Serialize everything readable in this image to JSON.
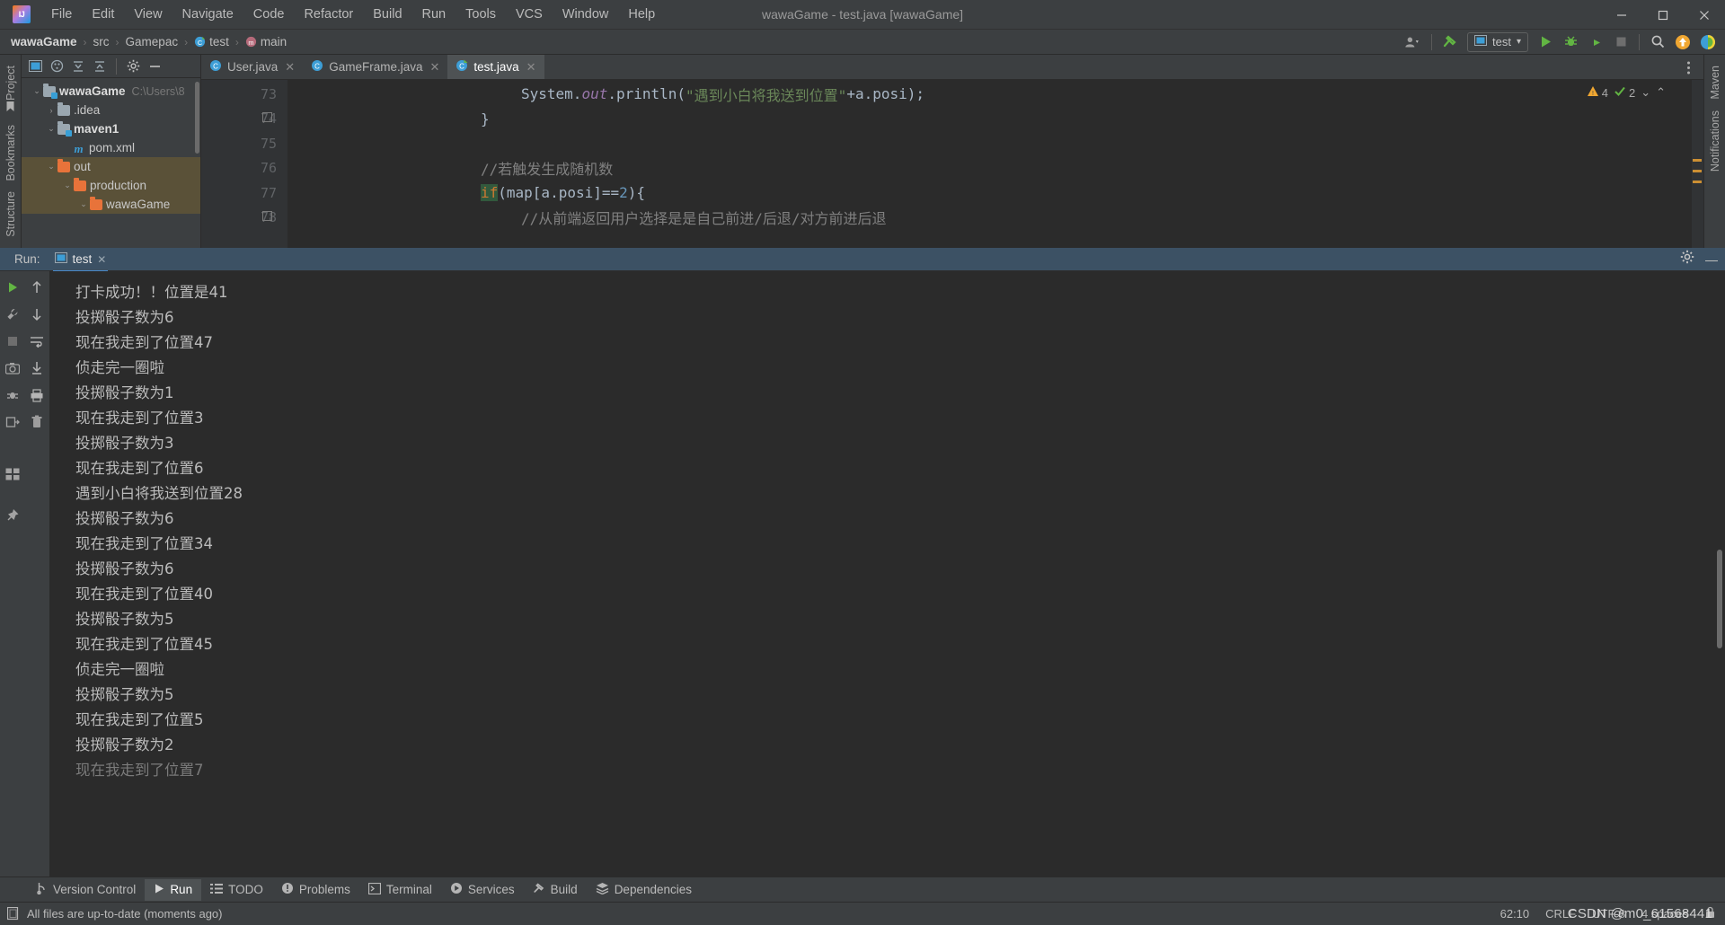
{
  "window": {
    "title": "wawaGame - test.java [wawaGame]",
    "logo_icon": "intellij-idea-logo",
    "minimize_icon": "minimize-icon",
    "maximize_icon": "maximize-icon",
    "close_icon": "close-icon",
    "minimize_glyph": "—",
    "maximize_glyph": "☐",
    "close_glyph": "✕"
  },
  "menubar": {
    "items": [
      {
        "label": "File"
      },
      {
        "label": "Edit"
      },
      {
        "label": "View"
      },
      {
        "label": "Navigate"
      },
      {
        "label": "Code"
      },
      {
        "label": "Refactor"
      },
      {
        "label": "Build"
      },
      {
        "label": "Run"
      },
      {
        "label": "Tools"
      },
      {
        "label": "VCS"
      },
      {
        "label": "Window"
      },
      {
        "label": "Help"
      }
    ]
  },
  "breadcrumb": {
    "items": [
      {
        "label": "wawaGame",
        "icon": ""
      },
      {
        "label": "src",
        "icon": ""
      },
      {
        "label": "Gamepac",
        "icon": ""
      },
      {
        "label": "test",
        "icon": "java-class-icon"
      },
      {
        "label": "main",
        "icon": "java-method-icon"
      }
    ],
    "separator": "›"
  },
  "navbar_right": {
    "account_label": "account-icon",
    "build_label": "build-hammer-icon",
    "run_config_name": "test",
    "run_config_icon": "run-configuration-icon",
    "dropdown_glyph": "▾",
    "run_icon": "run-button",
    "debug_icon": "debug-button",
    "coverage_icon": "run-with-coverage-button",
    "stop_icon": "stop-button",
    "search_icon": "search-everywhere-icon",
    "update_icon": "update-project-icon",
    "ide_icon": "ide-feature-icon"
  },
  "left_rail": {
    "top_label": "Project",
    "bottom_labels": [
      "Bookmarks",
      "Structure"
    ]
  },
  "right_rail": {
    "labels": [
      "Maven",
      "Notifications"
    ]
  },
  "project_panel": {
    "toolbar_icons": [
      "select-opened-file-icon",
      "scope-icon",
      "expand-all-icon",
      "collapse-all-icon",
      "settings-gear-icon",
      "hide-panel-icon"
    ],
    "tree": [
      {
        "label": "wawaGame",
        "path": "C:\\Users\\8",
        "depth": 0,
        "arrow": "⌄",
        "icon": "folder-module-gray",
        "bold": true,
        "selected": false
      },
      {
        "label": ".idea",
        "path": "",
        "depth": 1,
        "arrow": "›",
        "icon": "folder-gray",
        "bold": false,
        "selected": false
      },
      {
        "label": "maven1",
        "path": "",
        "depth": 1,
        "arrow": "⌄",
        "icon": "folder-module-gray",
        "bold": true,
        "selected": false
      },
      {
        "label": "pom.xml",
        "path": "",
        "depth": 2,
        "arrow": "",
        "icon": "maven-file-icon",
        "bold": false,
        "selected": false
      },
      {
        "label": "out",
        "path": "",
        "depth": 1,
        "arrow": "⌄",
        "icon": "folder-orange",
        "bold": false,
        "selected": true
      },
      {
        "label": "production",
        "path": "",
        "depth": 2,
        "arrow": "⌄",
        "icon": "folder-orange",
        "bold": false,
        "selected": true
      },
      {
        "label": "wawaGame",
        "path": "",
        "depth": 3,
        "arrow": "⌄",
        "icon": "folder-orange",
        "bold": false,
        "selected": true
      }
    ]
  },
  "editor": {
    "tabs": [
      {
        "label": "User.java",
        "icon": "java-class-icon",
        "active": false,
        "close_glyph": "✕"
      },
      {
        "label": "GameFrame.java",
        "icon": "java-class-icon",
        "active": false,
        "close_glyph": "✕"
      },
      {
        "label": "test.java",
        "icon": "java-runnable-class-icon",
        "active": true,
        "close_glyph": "✕"
      }
    ],
    "more_tabs_icon": "more-options-icon",
    "inspection": {
      "warning_icon": "warning-triangle-icon",
      "warning_count": "4",
      "check_icon": "inspection-check-icon",
      "check_count": "2",
      "chevron_down": "⌄",
      "chevron_up": "⌃"
    },
    "line_numbers": [
      "73",
      "74",
      "75",
      "76",
      "77",
      "78"
    ],
    "lines": [
      {
        "indent": 16,
        "tokens": [
          {
            "t": "System",
            "c": "tok-def"
          },
          {
            "t": ".",
            "c": "tok-def"
          },
          {
            "t": "out",
            "c": "tok-field"
          },
          {
            "t": ".println(",
            "c": "tok-def"
          },
          {
            "t": "\"遇到小白将我送到位置\"",
            "c": "tok-str"
          },
          {
            "t": "+a.posi);",
            "c": "tok-def"
          }
        ]
      },
      {
        "indent": 12,
        "tokens": [
          {
            "t": "}",
            "c": "tok-def"
          }
        ]
      },
      {
        "indent": 0,
        "tokens": []
      },
      {
        "indent": 12,
        "tokens": [
          {
            "t": "//若触发生成随机数",
            "c": "tok-cmt"
          }
        ]
      },
      {
        "indent": 12,
        "tokens": [
          {
            "t": "if",
            "c": "tok-kw kw-hl"
          },
          {
            "t": "(map[a.posi]==",
            "c": "tok-def"
          },
          {
            "t": "2",
            "c": "tok-num"
          },
          {
            "t": "){",
            "c": "tok-def"
          }
        ]
      },
      {
        "indent": 16,
        "tokens": [
          {
            "t": "//从前端返回用户选择是是自己前进/后退/对方前进后退",
            "c": "tok-cmt"
          }
        ]
      }
    ]
  },
  "run_window": {
    "title": "Run:",
    "tab_label": "test",
    "tab_icon": "run-configuration-icon",
    "tab_close_glyph": "✕",
    "settings_icon": "settings-gear-icon",
    "minimize_icon": "hide-panel-icon",
    "minimize_glyph": "—",
    "rail_left_icons": [
      "rerun-run-icon",
      "wrench-icon",
      "stop-icon",
      "camera-icon",
      "debug-attach-icon",
      "export-icon"
    ],
    "rail_right_icons": [
      "scroll-up-icon",
      "scroll-down-icon",
      "soft-wrap-icon",
      "scroll-to-end-icon",
      "print-icon",
      "trash-icon"
    ],
    "console_lines": [
      "打卡成功！！位置是41",
      "投掷骰子数为6",
      "现在我走到了位置47",
      "侦走完一圈啦",
      "投掷骰子数为1",
      "现在我走到了位置3",
      "投掷骰子数为3",
      "现在我走到了位置6",
      "遇到小白将我送到位置28",
      "投掷骰子数为6",
      "现在我走到了位置34",
      "投掷骰子数为6",
      "现在我走到了位置40",
      "投掷骰子数为5",
      "现在我走到了位置45",
      "侦走完一圈啦",
      "投掷骰子数为5",
      "现在我走到了位置5",
      "投掷骰子数为2",
      "现在我走到了位置7"
    ]
  },
  "bottom_toolbar": {
    "items": [
      {
        "label": "Version Control",
        "icon": "version-control-icon",
        "active": false
      },
      {
        "label": "Run",
        "icon": "run-icon",
        "active": true
      },
      {
        "label": "TODO",
        "icon": "todo-list-icon",
        "active": false
      },
      {
        "label": "Problems",
        "icon": "problems-icon",
        "active": false
      },
      {
        "label": "Terminal",
        "icon": "terminal-icon",
        "active": false
      },
      {
        "label": "Services",
        "icon": "services-icon",
        "active": false
      },
      {
        "label": "Build",
        "icon": "build-hammer-icon",
        "active": false
      },
      {
        "label": "Dependencies",
        "icon": "dependencies-icon",
        "active": false
      }
    ]
  },
  "statusbar": {
    "icon": "file-status-icon",
    "message": "All files are up-to-date (moments ago)",
    "caret_position": "62:10",
    "line_separator": "CRLF",
    "encoding": "UTF-8",
    "indent": "4 spaces",
    "lock_icon": "read-only-lock-icon"
  },
  "watermark": {
    "text": "CSDN @m0_61568441"
  },
  "colors": {
    "accent_blue": "#4a88c7",
    "bg_panel": "#3c3f41",
    "bg_editor": "#2b2b2b",
    "tree_selection": "#5a5138",
    "run_header": "#3c5164",
    "string_green": "#6a8759",
    "keyword_orange": "#cc7832",
    "number_blue": "#6897bb",
    "folder_orange": "#e8733a"
  }
}
